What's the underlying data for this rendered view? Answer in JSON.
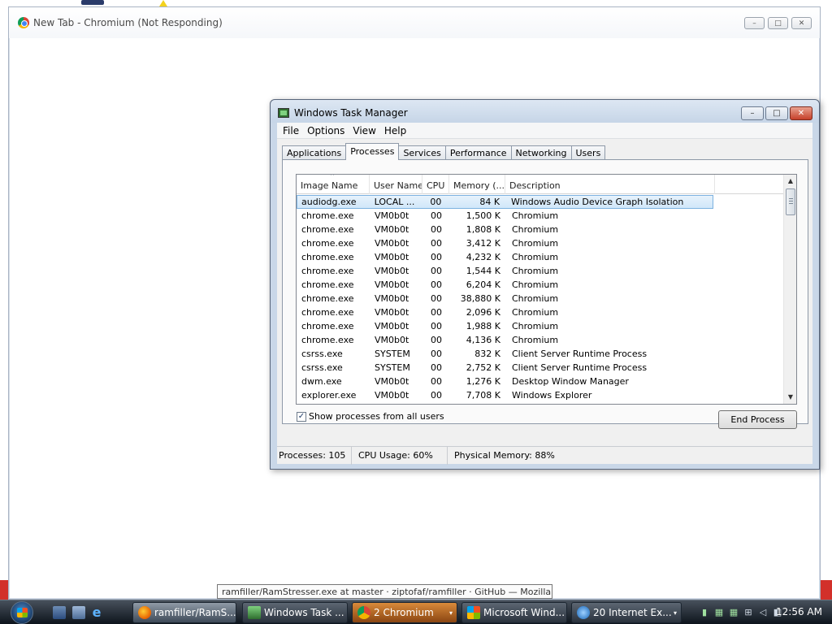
{
  "chromium": {
    "title": "New Tab - Chromium (Not Responding)",
    "controls": {
      "minimize": "–",
      "maximize": "□",
      "close": "✕"
    }
  },
  "task_manager": {
    "title": "Windows Task Manager",
    "controls": {
      "minimize": "–",
      "maximize": "□",
      "close": "✕"
    },
    "menu": [
      "File",
      "Options",
      "View",
      "Help"
    ],
    "tabs": [
      "Applications",
      "Processes",
      "Services",
      "Performance",
      "Networking",
      "Users"
    ],
    "active_tab": "Processes",
    "columns": [
      "Image Name",
      "User Name",
      "CPU",
      "Memory (...",
      "Description"
    ],
    "sort_indicator": "^",
    "rows": [
      {
        "name": "audiodg.exe",
        "user": "LOCAL ...",
        "cpu": "00",
        "mem": "84 K",
        "desc": "Windows Audio Device Graph Isolation"
      },
      {
        "name": "chrome.exe",
        "user": "VM0b0t",
        "cpu": "00",
        "mem": "1,500 K",
        "desc": "Chromium"
      },
      {
        "name": "chrome.exe",
        "user": "VM0b0t",
        "cpu": "00",
        "mem": "1,808 K",
        "desc": "Chromium"
      },
      {
        "name": "chrome.exe",
        "user": "VM0b0t",
        "cpu": "00",
        "mem": "3,412 K",
        "desc": "Chromium"
      },
      {
        "name": "chrome.exe",
        "user": "VM0b0t",
        "cpu": "00",
        "mem": "4,232 K",
        "desc": "Chromium"
      },
      {
        "name": "chrome.exe",
        "user": "VM0b0t",
        "cpu": "00",
        "mem": "1,544 K",
        "desc": "Chromium"
      },
      {
        "name": "chrome.exe",
        "user": "VM0b0t",
        "cpu": "00",
        "mem": "6,204 K",
        "desc": "Chromium"
      },
      {
        "name": "chrome.exe",
        "user": "VM0b0t",
        "cpu": "00",
        "mem": "38,880 K",
        "desc": "Chromium"
      },
      {
        "name": "chrome.exe",
        "user": "VM0b0t",
        "cpu": "00",
        "mem": "2,096 K",
        "desc": "Chromium"
      },
      {
        "name": "chrome.exe",
        "user": "VM0b0t",
        "cpu": "00",
        "mem": "1,988 K",
        "desc": "Chromium"
      },
      {
        "name": "chrome.exe",
        "user": "VM0b0t",
        "cpu": "00",
        "mem": "4,136 K",
        "desc": "Chromium"
      },
      {
        "name": "csrss.exe",
        "user": "SYSTEM",
        "cpu": "00",
        "mem": "832 K",
        "desc": "Client Server Runtime Process"
      },
      {
        "name": "csrss.exe",
        "user": "SYSTEM",
        "cpu": "00",
        "mem": "2,752 K",
        "desc": "Client Server Runtime Process"
      },
      {
        "name": "dwm.exe",
        "user": "VM0b0t",
        "cpu": "00",
        "mem": "1,276 K",
        "desc": "Desktop Window Manager"
      },
      {
        "name": "explorer.exe",
        "user": "VM0b0t",
        "cpu": "00",
        "mem": "7,708 K",
        "desc": "Windows Explorer"
      }
    ],
    "show_all_label": "Show processes from all users",
    "show_all_checked": "✓",
    "end_process_label": "End Process",
    "status": {
      "processes": "Processes: 105",
      "cpu": "CPU Usage: 60%",
      "memory": "Physical Memory: 88%"
    },
    "scroll": {
      "up": "▲",
      "down": "▼"
    }
  },
  "tooltip": "ramfiller/RamStresser.exe at master · ziptofaf/ramfiller · GitHub — Mozilla Fir",
  "taskbar": {
    "buttons": [
      {
        "label": "ramfiller/RamS...",
        "icon": "firefox-icon"
      },
      {
        "label": "Windows Task ...",
        "icon": "task-manager-icon"
      },
      {
        "label": "2 Chromium",
        "icon": "chromium-icon"
      },
      {
        "label": "Microsoft Wind...",
        "icon": "windows-icon"
      },
      {
        "label": "20 Internet Ex...",
        "icon": "internet-explorer-icon"
      }
    ],
    "group_arrow": "▾",
    "clock": "12:56 AM"
  }
}
